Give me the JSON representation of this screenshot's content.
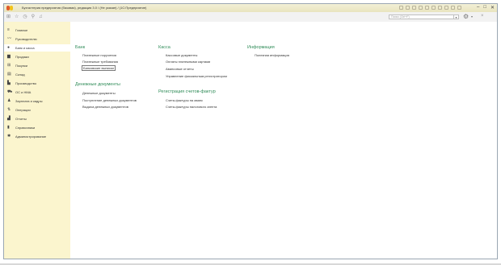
{
  "window": {
    "title": "Бухгалтерия предприятия (базовая), редакция 3.0 / (Не указан) / (1С:Предприятие)",
    "controls": [
      "–",
      "□",
      "✕"
    ]
  },
  "toolbar": {
    "search_placeholder": "Поиск (Ctrl+F)",
    "dropdown_glyph": "▾",
    "icons": [
      "apps-icon",
      "star-icon",
      "history-icon",
      "search-icon",
      "bell-icon"
    ]
  },
  "sidebar": {
    "items": [
      {
        "label": "Главное",
        "icon": "menu-icon",
        "glyph": "≡"
      },
      {
        "label": "Руководителю",
        "icon": "chart-line-icon",
        "glyph": "〰"
      },
      {
        "label": "Банк и касса",
        "icon": "coin-icon",
        "glyph": "●"
      },
      {
        "label": "Продажи",
        "icon": "bag-icon",
        "glyph": "▆"
      },
      {
        "label": "Покупки",
        "icon": "cart-icon",
        "glyph": "⊞"
      },
      {
        "label": "Склад",
        "icon": "warehouse-icon",
        "glyph": "▤"
      },
      {
        "label": "Производство",
        "icon": "factory-icon",
        "glyph": "▙"
      },
      {
        "label": "ОС и НМА",
        "icon": "assets-icon",
        "glyph": "⛟"
      },
      {
        "label": "Зарплата и кадры",
        "icon": "people-icon",
        "glyph": "♟"
      },
      {
        "label": "Операции",
        "icon": "operations-icon",
        "glyph": "⇅"
      },
      {
        "label": "Отчеты",
        "icon": "reports-icon",
        "glyph": "▟"
      },
      {
        "label": "Справочники",
        "icon": "book-icon",
        "glyph": "▮"
      },
      {
        "label": "Администрирование",
        "icon": "admin-gear-icon",
        "glyph": "✱"
      }
    ],
    "active_index": 2
  },
  "main": {
    "bank": {
      "title": "Банк",
      "links": [
        "Платежные поручения",
        "Платежные требования",
        "Банковские выписки"
      ]
    },
    "money_docs": {
      "title": "Денежные документы",
      "links": [
        "Денежные документы",
        "Поступление денежных документов",
        "Выдача денежных документов"
      ]
    },
    "cash": {
      "title": "Касса",
      "links": [
        "Кассовые документы",
        "Оплаты платежными картами",
        "Авансовые отчеты",
        "Управление фискальным регистратором"
      ]
    },
    "invoices": {
      "title": "Регистрация счетов-фактур",
      "links": [
        "Счета-фактуры на аванс",
        "Счета-фактуры налогового агента"
      ]
    },
    "info": {
      "title": "Информация",
      "links": [
        "Полезная информация"
      ]
    }
  },
  "colors": {
    "accent_green": "#2e8b57",
    "sidebar_bg": "#fbf5ce",
    "titlebar_bg": "#efeacb"
  }
}
